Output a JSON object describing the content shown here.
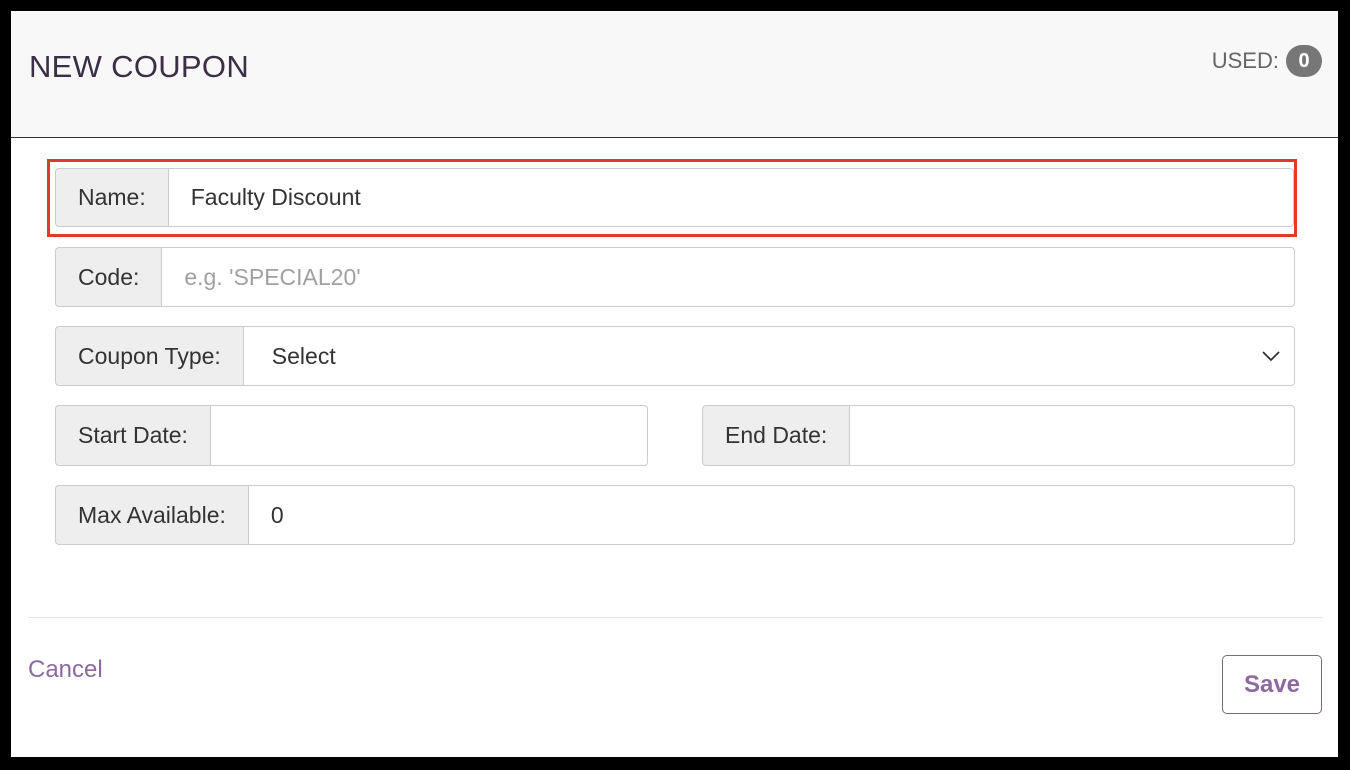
{
  "dialog": {
    "title": "NEW COUPON",
    "used_label": "USED:",
    "used_count": "0"
  },
  "form": {
    "name": {
      "label": "Name:",
      "value": "Faculty Discount",
      "highlighted": true,
      "highlight_color": "#e03a2a"
    },
    "code": {
      "label": "Code:",
      "value": "",
      "placeholder": "e.g. 'SPECIAL20'"
    },
    "coupon_type": {
      "label": "Coupon Type:",
      "selected": "Select"
    },
    "start_date": {
      "label": "Start Date:",
      "value": ""
    },
    "end_date": {
      "label": "End Date:",
      "value": ""
    },
    "max_available": {
      "label": "Max Available:",
      "value": "0"
    }
  },
  "footer": {
    "cancel_label": "Cancel",
    "save_label": "Save"
  },
  "colors": {
    "accent": "#8c6aa0",
    "badge": "#777777",
    "highlight": "#e03a2a"
  },
  "icons": {
    "select_arrow": "chevron-down-icon"
  }
}
